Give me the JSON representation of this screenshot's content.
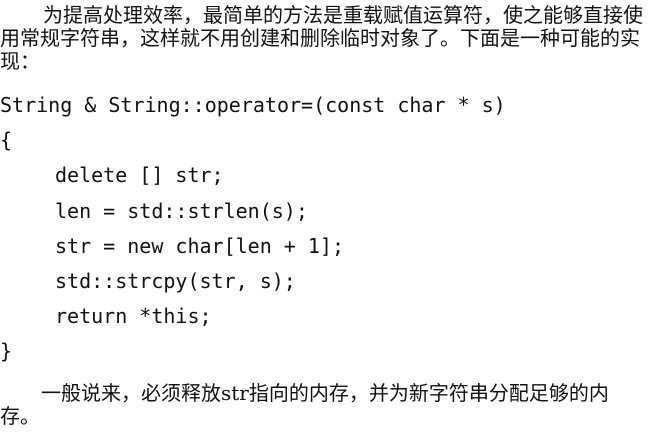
{
  "intro_paragraph": "为提高处理效率，最简单的方法是重载赋值运算符，使之能够直接使用常规字符串，这样就不用创建和删除临时对象了。下面是一种可能的实现：",
  "code_lines": [
    "String & String::operator=(const char * s)",
    "{",
    "delete [] str;",
    "len = std::strlen(s);",
    "str = new char[len + 1];",
    "std::strcpy(str, s);",
    "return *this;",
    "}"
  ],
  "closing_paragraph": "一般说来，必须释放str指向的内存，并为新字符串分配足够的内存。"
}
